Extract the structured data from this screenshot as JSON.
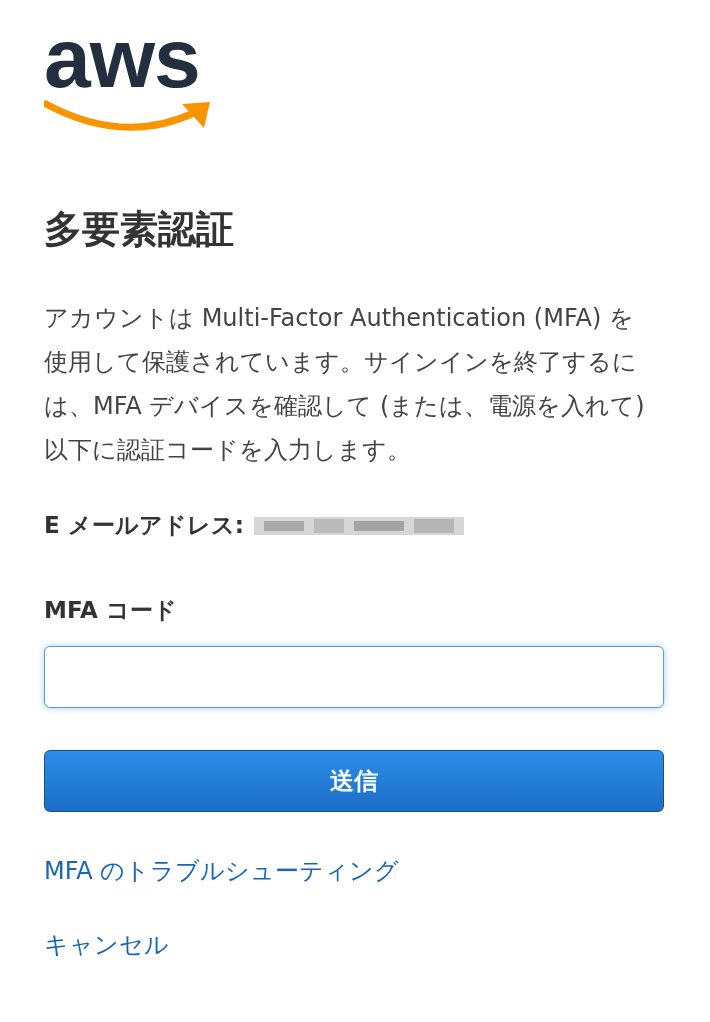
{
  "logo": {
    "text": "aws"
  },
  "title": "多要素認証",
  "description": "アカウントは Multi-Factor Authentication (MFA) を使用して保護されています。サインインを終了するには、MFA デバイスを確認して (または、電源を入れて) 以下に認証コードを入力します。",
  "email": {
    "label": "E メールアドレス:"
  },
  "mfa_code": {
    "label": "MFA コード"
  },
  "submit_button": "送信",
  "links": [
    {
      "label": "MFA のトラブルシューティング"
    },
    {
      "label": "キャンセル"
    }
  ]
}
